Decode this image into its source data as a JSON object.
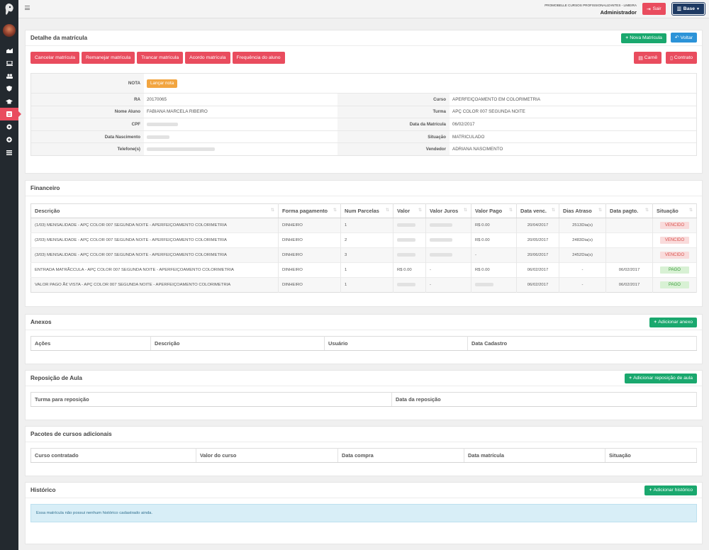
{
  "topbar": {
    "school": "PROMOBELLE CURSOS PROFISSIONALIZANTES - LIMEIRA",
    "user": "Administrador",
    "logout_label": "Sair",
    "base_label": "Base"
  },
  "sidebar": {
    "icons": [
      "chart-icon",
      "laptop-icon",
      "users-icon",
      "shield-icon",
      "graduation-cap-icon",
      "enrollment-icon",
      "money-icon",
      "settings-icon",
      "list-icon"
    ]
  },
  "detail": {
    "title": "Detalhe da matrícula",
    "new_label": "Nova Matrícula",
    "back_label": "Voltar",
    "actions": [
      "Cancelar matrícula",
      "Remanejar matrícula",
      "Trancar matrícula",
      "Acordo matrícula",
      "Frequência do aluno"
    ],
    "carne_label": "Carnê",
    "contrato_label": "Contrato",
    "nota_label": "NOTA",
    "lancar_nota_label": "Lançar nota",
    "fields": {
      "ra_label": "RA",
      "ra": "20170065",
      "curso_label": "Curso",
      "curso": "APERFEIÇOAMENTO EM COLORIMETRIA",
      "nome_label": "Nome Aluno",
      "nome": "FABIANA MARCELA RIBEIRO",
      "turma_label": "Turma",
      "turma": "APÇ COLOR 007 SEGUNDA NOITE",
      "cpf_label": "CPF",
      "data_matricula_label": "Data da Matrícula",
      "data_matricula": "06/02/2017",
      "nascimento_label": "Data Nascimento",
      "situacao_label": "Situação",
      "situacao": "MATRICULADO",
      "telefone_label": "Telefone(s)",
      "vendedor_label": "Vendedor",
      "vendedor": "ADRIANA NASCIMENTO"
    }
  },
  "financeiro": {
    "title": "Financeiro",
    "columns": [
      "Descrição",
      "Forma pagamento",
      "Num Parcelas",
      "Valor",
      "Valor Juros",
      "Valor Pago",
      "Data venc.",
      "Dias Atraso",
      "Data pagto.",
      "Situação"
    ],
    "rows": [
      {
        "descricao": "(1/03) MENSALIDADE - APÇ COLOR 007 SEGUNDA NOITE - APERFEIÇOAMENTO COLORIMETRIA",
        "forma": "DINHEIRO",
        "parcelas": "1",
        "valor": "",
        "juros": "",
        "pago": "R$ 0.00",
        "venc": "20/04/2017",
        "atraso": "2513Dia(s)",
        "pagto": "",
        "situacao": "VENCIDO"
      },
      {
        "descricao": "(2/03) MENSALIDADE - APÇ COLOR 007 SEGUNDA NOITE - APERFEIÇOAMENTO COLORIMETRIA",
        "forma": "DINHEIRO",
        "parcelas": "2",
        "valor": "",
        "juros": "",
        "pago": "R$ 0.00",
        "venc": "20/05/2017",
        "atraso": "2483Dia(s)",
        "pagto": "",
        "situacao": "VENCIDO"
      },
      {
        "descricao": "(3/03) MENSALIDADE - APÇ COLOR 007 SEGUNDA NOITE - APERFEIÇOAMENTO COLORIMETRIA",
        "forma": "DINHEIRO",
        "parcelas": "3",
        "valor": "",
        "juros": "",
        "pago": "-",
        "venc": "20/06/2017",
        "atraso": "2452Dia(s)",
        "pagto": "",
        "situacao": "VENCIDO"
      },
      {
        "descricao": "ENTRADA MATRÃCCULA - APÇ COLOR 007 SEGUNDA NOITE - APERFEIÇOAMENTO COLORIMETRIA",
        "forma": "DINHEIRO",
        "parcelas": "1",
        "valor": "R$ 0.00",
        "juros": "-",
        "pago": "R$ 0.00",
        "venc": "06/02/2017",
        "atraso": "-",
        "pagto": "06/02/2017",
        "situacao": "PAGO"
      },
      {
        "descricao": "VALOR PAGO Ã€ VISTA - APÇ COLOR 007 SEGUNDA NOITE - APERFEIÇOAMENTO COLORIMETRIA",
        "forma": "DINHEIRO",
        "parcelas": "1",
        "valor": "",
        "juros": "-",
        "pago": "",
        "venc": "06/02/2017",
        "atraso": "-",
        "pagto": "06/02/2017",
        "situacao": "PAGO"
      }
    ]
  },
  "anexos": {
    "title": "Anexos",
    "add_label": "Adicionar anexo",
    "columns": [
      "Ações",
      "Descrição",
      "Usuário",
      "Data Cadastro"
    ]
  },
  "reposicao": {
    "title": "Reposição de Aula",
    "add_label": "Adicionar reposição de aula",
    "columns": [
      "Turma para reposição",
      "Data da reposição"
    ]
  },
  "pacotes": {
    "title": "Pacotes de cursos adicionais",
    "columns": [
      "Curso contratado",
      "Valor do curso",
      "Data compra",
      "Data matrícula",
      "Situação"
    ]
  },
  "historico": {
    "title": "Histórico",
    "add_label": "Adicionar histórico",
    "empty_message": "Essa matrícula não possui nenhum histórico cadastrado ainda."
  }
}
